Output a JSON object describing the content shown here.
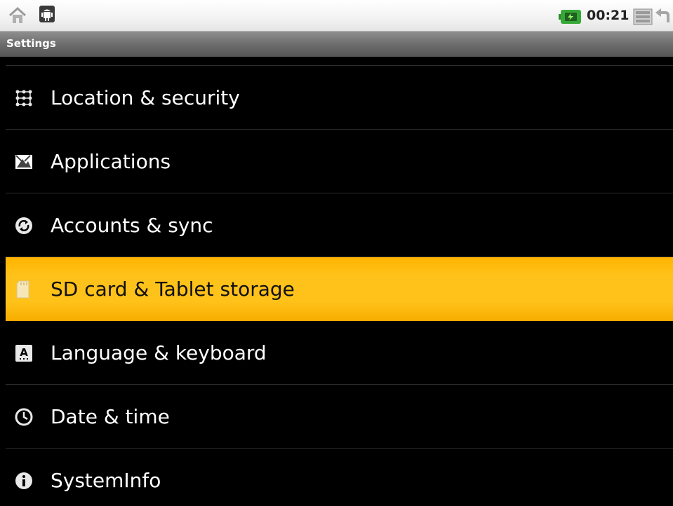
{
  "status_bar": {
    "time": "00:21",
    "icons": [
      "home-icon",
      "debug-icon",
      "battery-charging-icon",
      "menu-icon",
      "back-icon"
    ]
  },
  "title_bar": {
    "title": "Settings"
  },
  "settings": {
    "selected_index": 3,
    "highlight_color": "#ffc21a",
    "items": [
      {
        "label": "Location & security",
        "icon": "location-security-icon"
      },
      {
        "label": "Applications",
        "icon": "applications-icon"
      },
      {
        "label": "Accounts & sync",
        "icon": "accounts-sync-icon"
      },
      {
        "label": "SD card & Tablet storage",
        "icon": "sd-card-icon"
      },
      {
        "label": "Language & keyboard",
        "icon": "language-keyboard-icon"
      },
      {
        "label": "Date & time",
        "icon": "clock-icon"
      },
      {
        "label": "SystemInfo",
        "icon": "info-icon"
      }
    ]
  }
}
